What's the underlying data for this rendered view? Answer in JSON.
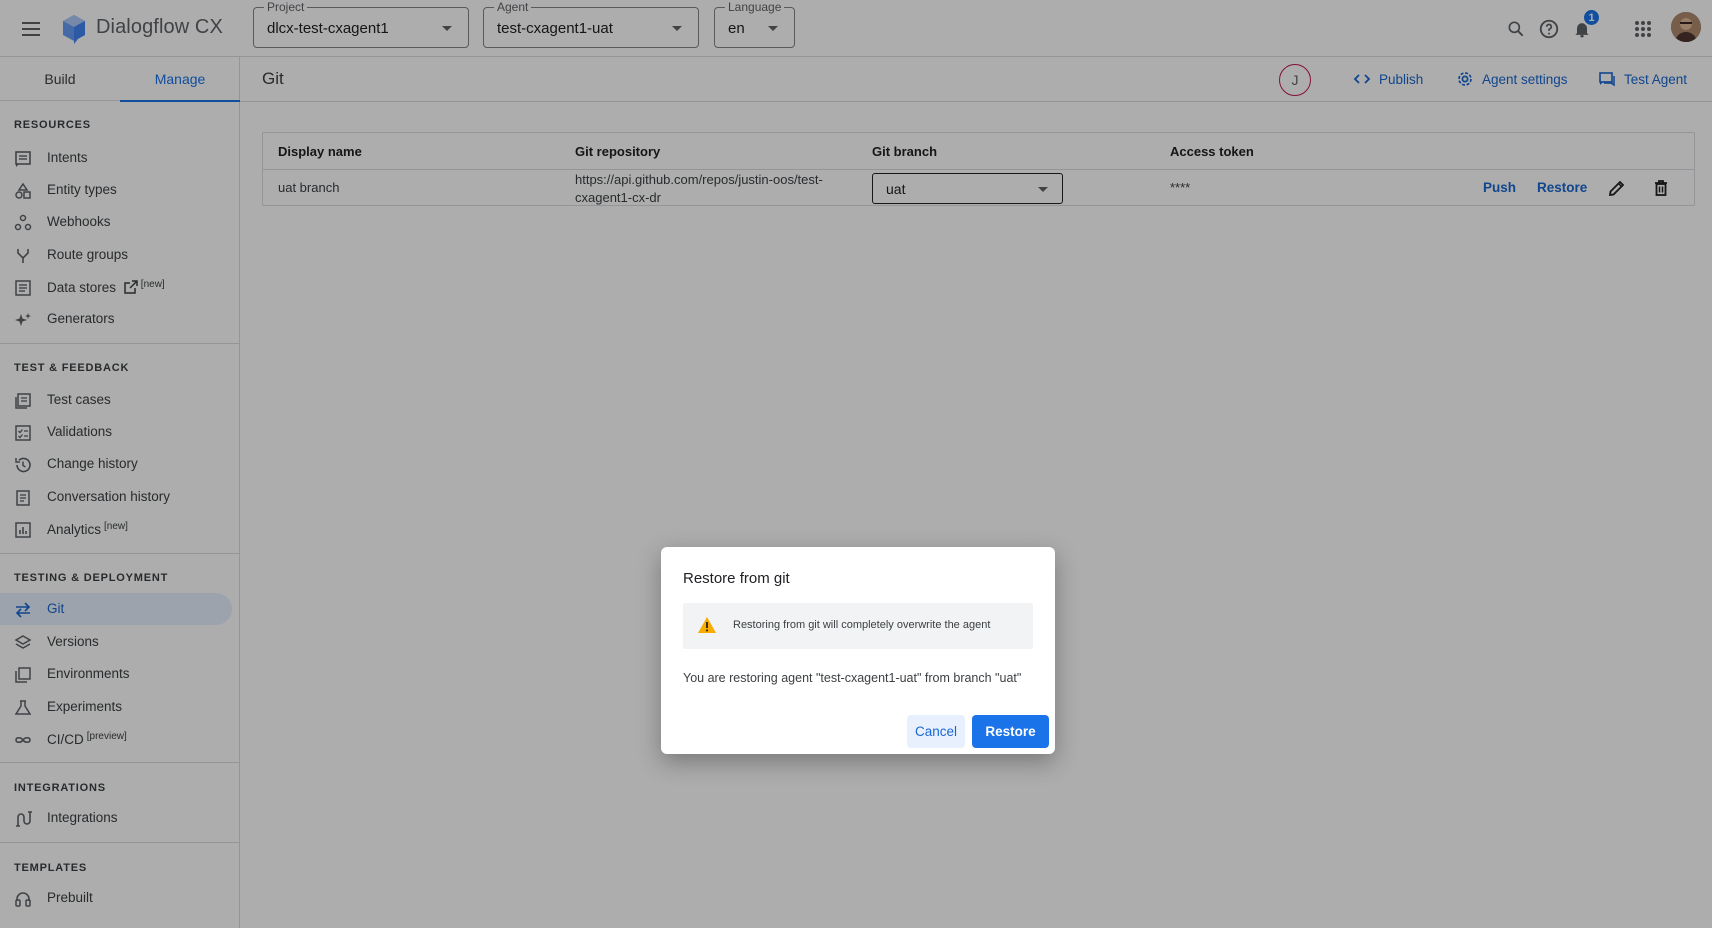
{
  "app": {
    "title": "Dialogflow CX"
  },
  "selectors": {
    "project": {
      "label": "Project",
      "value": "dlcx-test-cxagent1"
    },
    "agent": {
      "label": "Agent",
      "value": "test-cxagent1-uat"
    },
    "language": {
      "label": "Language",
      "value": "en"
    }
  },
  "topbar": {
    "notification_count": "1"
  },
  "sidebar": {
    "tabs": [
      {
        "label": "Build"
      },
      {
        "label": "Manage"
      }
    ],
    "sections": {
      "resources": {
        "title": "RESOURCES",
        "items": [
          {
            "label": "Intents",
            "icon": "intents-icon"
          },
          {
            "label": "Entity types",
            "icon": "entity-types-icon"
          },
          {
            "label": "Webhooks",
            "icon": "webhooks-icon"
          },
          {
            "label": "Route groups",
            "icon": "route-groups-icon"
          },
          {
            "label": "Data stores",
            "icon": "data-stores-icon",
            "tag": "[new]"
          },
          {
            "label": "Generators",
            "icon": "generators-icon"
          }
        ]
      },
      "test_feedback": {
        "title": "TEST & FEEDBACK",
        "items": [
          {
            "label": "Test cases",
            "icon": "test-cases-icon"
          },
          {
            "label": "Validations",
            "icon": "validations-icon"
          },
          {
            "label": "Change history",
            "icon": "history-icon"
          },
          {
            "label": "Conversation history",
            "icon": "conversation-history-icon"
          },
          {
            "label": "Analytics",
            "icon": "analytics-icon",
            "tag": "[new]"
          }
        ]
      },
      "testing_deployment": {
        "title": "TESTING & DEPLOYMENT",
        "items": [
          {
            "label": "Git",
            "icon": "git-icon"
          },
          {
            "label": "Versions",
            "icon": "versions-icon"
          },
          {
            "label": "Environments",
            "icon": "environments-icon"
          },
          {
            "label": "Experiments",
            "icon": "experiments-icon"
          },
          {
            "label": "CI/CD",
            "icon": "cicd-icon",
            "tag": "[preview]"
          }
        ]
      },
      "integrations": {
        "title": "INTEGRATIONS",
        "items": [
          {
            "label": "Integrations",
            "icon": "integrations-icon"
          }
        ]
      },
      "templates": {
        "title": "TEMPLATES",
        "items": [
          {
            "label": "Prebuilt",
            "icon": "prebuilt-icon"
          }
        ]
      }
    }
  },
  "main": {
    "title": "Git",
    "user_initial": "J",
    "actions": {
      "publish": "Publish",
      "agent_settings": "Agent settings",
      "test_agent": "Test Agent"
    },
    "table": {
      "headers": {
        "display_name": "Display name",
        "repo": "Git repository",
        "branch": "Git branch",
        "token": "Access token"
      },
      "row": {
        "display_name": "uat branch",
        "repo_line1": "https://api.github.com/repos/justin-oos/test-",
        "repo_line2": "cxagent1-cx-dr",
        "branch": "uat",
        "token": "****",
        "push": "Push",
        "restore": "Restore"
      }
    }
  },
  "dialog": {
    "title": "Restore from git",
    "warning": "Restoring from git will completely overwrite the agent",
    "message": "You are restoring agent \"test-cxagent1-uat\" from branch \"uat\"",
    "cancel": "Cancel",
    "restore": "Restore"
  },
  "colors": {
    "accent": "#1a73e8",
    "warning": "#f9ab00"
  }
}
